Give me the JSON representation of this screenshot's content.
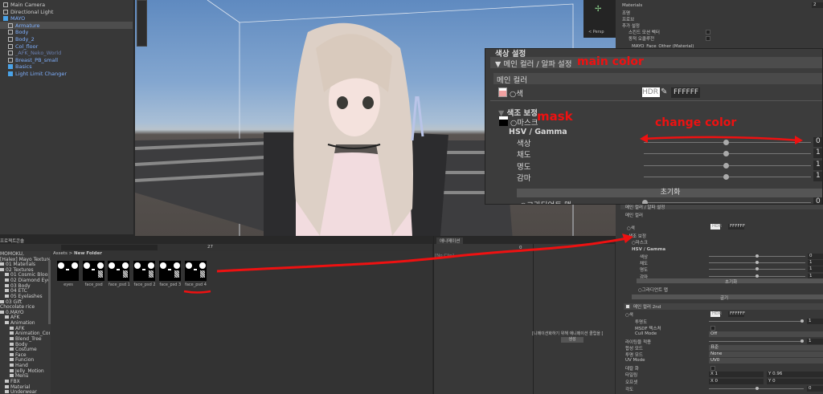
{
  "hierarchy": {
    "items": [
      {
        "label": "Main Camera",
        "style": "normal"
      },
      {
        "label": "Directional Light",
        "style": "normal"
      },
      {
        "label": "MAYO",
        "style": "blue"
      },
      {
        "label": "Armature",
        "style": "blue"
      },
      {
        "label": "Body",
        "style": "blue"
      },
      {
        "label": "Body_2",
        "style": "blue"
      },
      {
        "label": "Col_floor",
        "style": "blue"
      },
      {
        "label": "_AFK_Neko_World",
        "style": "dim"
      },
      {
        "label": "Breast_PB_small",
        "style": "blue"
      },
      {
        "label": "Basics",
        "style": "blue"
      },
      {
        "label": "Light Limit Changer",
        "style": "blue"
      }
    ]
  },
  "scene": {
    "gizmo_label": "< Persp"
  },
  "inspector": {
    "materials_label": "Materials",
    "materials_count": "2",
    "sections": [
      "조명",
      "프로브",
      "추가 설정"
    ],
    "options": [
      "스킨드 모션 벡터",
      "동적 오클루전"
    ],
    "material_name": "MAYO_Face_Other (Material)",
    "main_header": "메인 컬러 / 알파 설정",
    "main_color_label": "메인 컬러",
    "color_label": "○색",
    "hdr": "HDR",
    "hex": "FFFFFF",
    "hue_section": "색조 보정",
    "mask_label": "○마스크",
    "hsv_label": "HSV / Gamma",
    "sliders": [
      {
        "label": "색상",
        "value": "0"
      },
      {
        "label": "채도",
        "value": "1"
      },
      {
        "label": "명도",
        "value": "1"
      },
      {
        "label": "감마",
        "value": "1"
      }
    ],
    "reset_button": "초기화",
    "gradient_label": "○그라디언트 맵",
    "gradient_value": "0",
    "edit_button": "굽기",
    "second_header": "메인 컬러 2nd",
    "second_rows": [
      {
        "label": "○색",
        "value": "FFFFFF"
      },
      {
        "label": "투명도",
        "value": "1"
      },
      {
        "label": "MSDF 텍스처",
        "value": ""
      },
      {
        "label": "Cull Mode",
        "value": "Off"
      },
      {
        "label": "라이팅을 적용",
        "value": "1"
      },
      {
        "label": "합성 모드",
        "value": "표준"
      },
      {
        "label": "투명 모드",
        "value": "None"
      },
      {
        "label": "UV Mode",
        "value": "UV0"
      },
      {
        "label": "데칼 화",
        "value": ""
      },
      {
        "label": "타일링",
        "x": "1",
        "y": "0.96"
      },
      {
        "label": "오프셋",
        "x": "0",
        "y": "0"
      },
      {
        "label": "각도",
        "value": "0"
      }
    ],
    "top_partial": "색상 설정"
  },
  "project": {
    "tabs": [
      "프로젝트",
      "콘솔"
    ],
    "tree": [
      {
        "label": "MOMOKU,",
        "indent": 0,
        "folder": false
      },
      {
        "label": "[Halex] Mayo Textures P",
        "indent": 0,
        "folder": false
      },
      {
        "label": "01 Materials",
        "indent": 0,
        "folder": true
      },
      {
        "label": "02 Textures",
        "indent": 0,
        "folder": true
      },
      {
        "label": "01 Cosmic Bloom E",
        "indent": 1,
        "folder": true
      },
      {
        "label": "02 Diamond Eyes",
        "indent": 1,
        "folder": true
      },
      {
        "label": "03 Body",
        "indent": 1,
        "folder": true
      },
      {
        "label": "04 ETC",
        "indent": 1,
        "folder": true
      },
      {
        "label": "05 Eyelashes",
        "indent": 1,
        "folder": true
      },
      {
        "label": "03 Gift",
        "indent": 0,
        "folder": true
      },
      {
        "label": "Chocolate rice",
        "indent": 0,
        "folder": false
      },
      {
        "label": "0.MAYO",
        "indent": 0,
        "folder": true
      },
      {
        "label": "AFK",
        "indent": 1,
        "folder": true
      },
      {
        "label": "Animation",
        "indent": 1,
        "folder": true
      },
      {
        "label": "AFK",
        "indent": 2,
        "folder": true
      },
      {
        "label": "Animation_Contr",
        "indent": 2,
        "folder": true
      },
      {
        "label": "Blend_Tree",
        "indent": 2,
        "folder": true
      },
      {
        "label": "Body",
        "indent": 2,
        "folder": true
      },
      {
        "label": "Costume",
        "indent": 2,
        "folder": true
      },
      {
        "label": "Face",
        "indent": 2,
        "folder": true
      },
      {
        "label": "Funcion",
        "indent": 2,
        "folder": true
      },
      {
        "label": "Hand",
        "indent": 2,
        "folder": true
      },
      {
        "label": "Jelly_Motion",
        "indent": 2,
        "folder": true
      },
      {
        "label": "Menu",
        "indent": 2,
        "folder": true
      },
      {
        "label": "FBX",
        "indent": 1,
        "folder": true
      },
      {
        "label": "Material",
        "indent": 1,
        "folder": true
      },
      {
        "label": "Underwear",
        "indent": 1,
        "folder": true
      }
    ],
    "breadcrumb": [
      "Assets",
      "New Folder"
    ],
    "assets": [
      "eyes",
      "face_psd",
      "face_psd 1",
      "face_psd 2",
      "face_psd 3",
      "face_psd 4"
    ],
    "hidden_count": "27"
  },
  "animation": {
    "tab": "애니메이션",
    "clip": "[No Clip]",
    "frame": "0",
    "message": "[니메이션화하기 위해 애니메이션 클립을 [",
    "create_button": "생성"
  },
  "annotations": {
    "main_color": "main color",
    "mask": "mask",
    "change_color": "change color",
    "color": "#ee1111"
  }
}
